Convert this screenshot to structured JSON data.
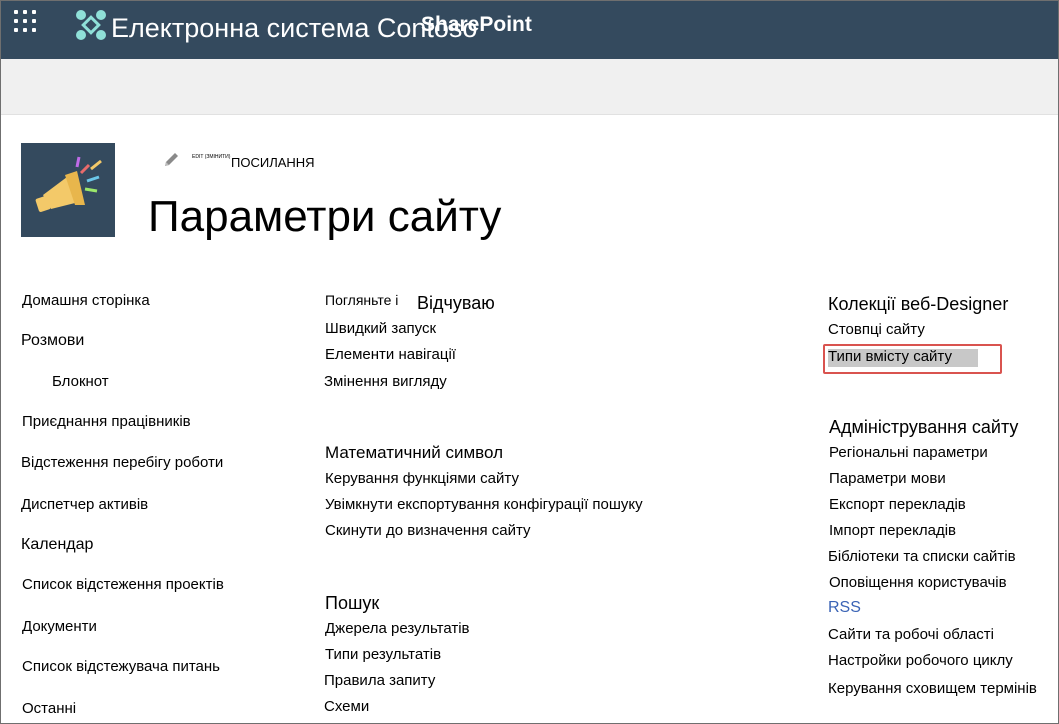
{
  "header": {
    "app_title": "Електронна система Contoso",
    "brand": "SharePoint"
  },
  "site": {
    "edit_tiny": "EDIT (ЗМІНИТИ)",
    "links_label": "ПОСИЛАННЯ",
    "page_title": "Параметри сайту"
  },
  "left_nav": [
    "Домашня сторінка",
    "Розмови",
    "Блокнот",
    "Приєднання працівників",
    "Відстеження перебігу роботи",
    "Диспетчер активів",
    "Календар",
    "Список відстеження проектів",
    "Документи",
    "Список відстежувача питань",
    "Останні"
  ],
  "look_section": {
    "prefix": "Погляньте і",
    "heading": "Відчуваю",
    "items": [
      "Швидкий запуск",
      "Елементи  навігації",
      "Змінення вигляду"
    ]
  },
  "actions_section": {
    "heading": "Математичний символ",
    "items": [
      "Керування функціями сайту",
      "Увімкнути експортування конфігурації пошуку",
      "Скинути до визначення сайту"
    ]
  },
  "search_section": {
    "heading": "Пошук",
    "items": [
      "Джерела результатів",
      "Типи результатів",
      "Правила запиту",
      "Схеми"
    ]
  },
  "designer_section": {
    "heading": "Колекції веб-Designer",
    "items": [
      "Стовпці сайту",
      "Типи вмісту сайту"
    ]
  },
  "admin_section": {
    "heading": "Адміністрування сайту",
    "items": [
      "Регіональні параметри",
      "Параметри мови",
      "Експорт перекладів",
      "Імпорт перекладів",
      "Бібліотеки та списки сайтів",
      "Оповіщення користувачів",
      "RSS",
      "Сайти та робочі області",
      "Настройки робочого циклу",
      "Керування сховищем термінів"
    ]
  },
  "colors": {
    "topbar": "#344a5e",
    "highlight_border": "#d9534f",
    "rss_link": "#3a63b5"
  }
}
